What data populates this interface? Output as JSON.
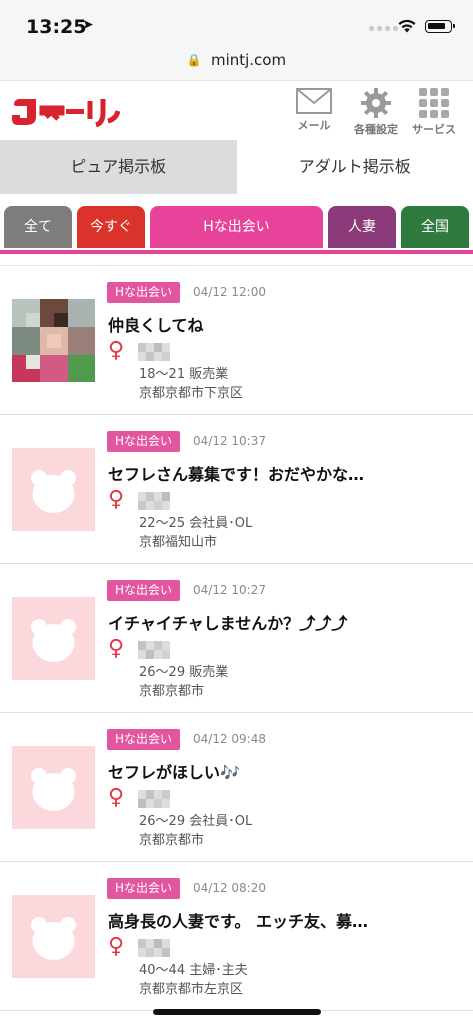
{
  "status": {
    "time": "13:25",
    "location_icon": "location-arrow-icon"
  },
  "browser": {
    "url": "mintj.com"
  },
  "header": {
    "logo_text": "Jメール",
    "buttons": [
      {
        "label": "メール",
        "icon": "mail-icon"
      },
      {
        "label": "各種設定",
        "icon": "gear-icon"
      },
      {
        "label": "サービス",
        "icon": "grid-icon"
      }
    ]
  },
  "board_tabs": [
    {
      "label": "ピュア掲示板",
      "active": false
    },
    {
      "label": "アダルト掲示板",
      "active": true
    }
  ],
  "category_tabs": [
    {
      "label": "全て",
      "color": "#7d7d7d"
    },
    {
      "label": "今すぐ",
      "color": "#d9332b"
    },
    {
      "label": "Hな出会い",
      "color": "#e8439a",
      "active": true
    },
    {
      "label": "人妻",
      "color": "#8a3a78"
    },
    {
      "label": "全国",
      "color": "#2f7a3f"
    }
  ],
  "posts": [
    {
      "badge": "Hな出会い",
      "date": "04/12 12:00",
      "title": "仲良くしてね",
      "age_job": "18〜21 販売業",
      "area": "京都京都市下京区",
      "has_photo": true
    },
    {
      "badge": "Hな出会い",
      "date": "04/12 10:37",
      "title": "セフレさん募集です！おだやかな…",
      "age_job": "22〜25 会社員･OL",
      "area": "京都福知山市",
      "has_photo": false
    },
    {
      "badge": "Hな出会い",
      "date": "04/12 10:27",
      "title": "イチャイチャしませんか？⤴︎⤴︎⤴︎",
      "age_job": "26〜29 販売業",
      "area": "京都京都市",
      "has_photo": false
    },
    {
      "badge": "Hな出会い",
      "date": "04/12 09:48",
      "title": "セフレがほしい🎶",
      "age_job": "26〜29 会社員･OL",
      "area": "京都京都市",
      "has_photo": false
    },
    {
      "badge": "Hな出会い",
      "date": "04/12 08:20",
      "title": "高身長の人妻です。 エッチ友、募…",
      "age_job": "40〜44 主婦･主夫",
      "area": "京都京都市左京区",
      "has_photo": false
    }
  ],
  "colors": {
    "accent": "#e8439a",
    "badge": "#e2559f",
    "female": "#e23a45",
    "logo": "#d7232e"
  }
}
